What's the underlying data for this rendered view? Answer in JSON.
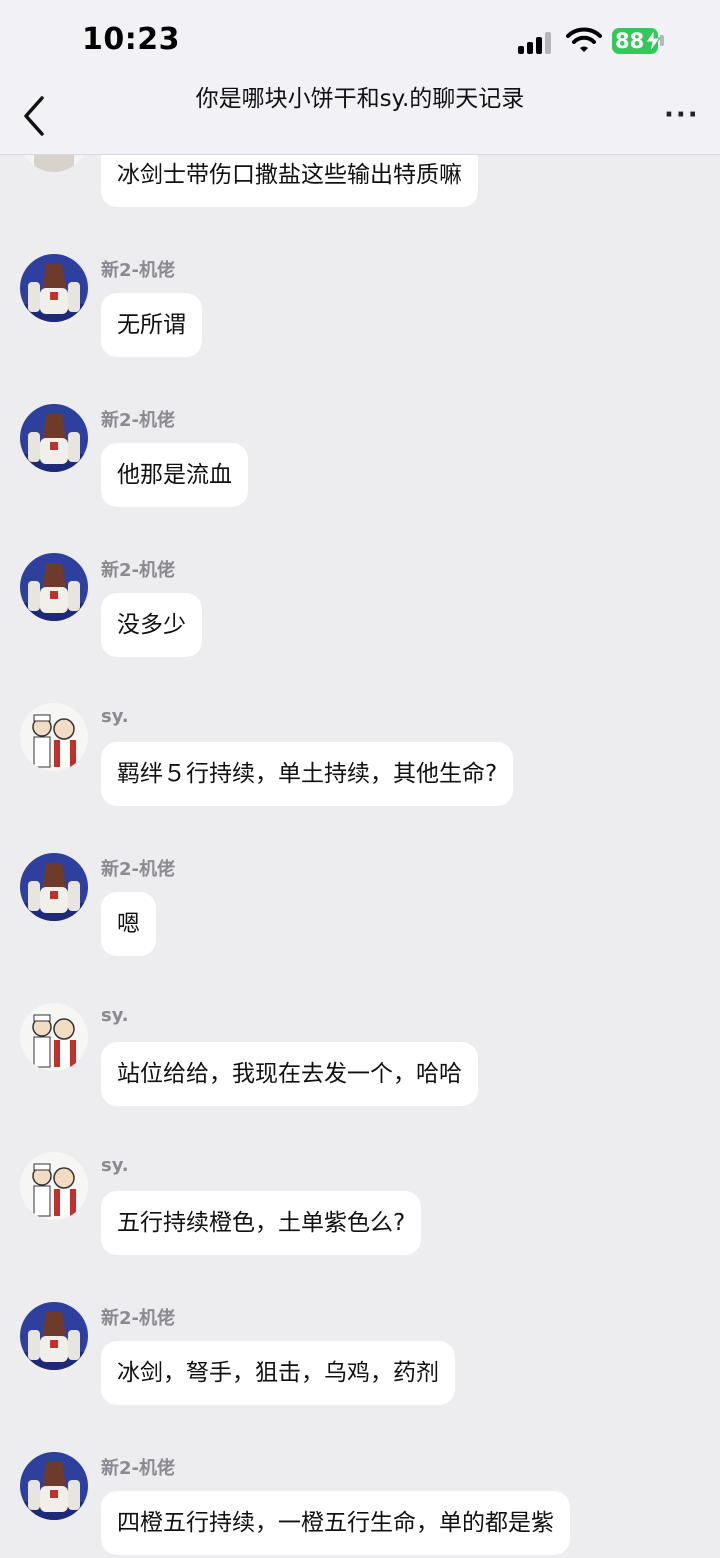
{
  "status_bar": {
    "time": "10:23",
    "battery": "88"
  },
  "nav": {
    "title": "你是哪块小饼干和sy.的聊天记录",
    "more": "···"
  },
  "messages": [
    {
      "sender": "",
      "avatar": "horse-avatar",
      "text": "冰剑士带伤口撒盐这些输出特质嘛"
    },
    {
      "sender": "新2-机佬",
      "avatar": "horse-avatar",
      "text": "无所谓"
    },
    {
      "sender": "新2-机佬",
      "avatar": "horse-avatar",
      "text": "他那是流血"
    },
    {
      "sender": "新2-机佬",
      "avatar": "horse-avatar",
      "text": "没多少"
    },
    {
      "sender": "sy.",
      "avatar": "cartoon-couple-avatar",
      "text": "羁绊５行持续，单土持续，其他生命?"
    },
    {
      "sender": "新2-机佬",
      "avatar": "horse-avatar",
      "text": "嗯"
    },
    {
      "sender": "sy.",
      "avatar": "cartoon-couple-avatar",
      "text": "站位给给，我现在去发一个，哈哈"
    },
    {
      "sender": "sy.",
      "avatar": "cartoon-couple-avatar",
      "text": "五行持续橙色，土单紫色么?"
    },
    {
      "sender": "新2-机佬",
      "avatar": "horse-avatar",
      "text": "冰剑，弩手，狙击，乌鸡，药剂"
    },
    {
      "sender": "新2-机佬",
      "avatar": "horse-avatar",
      "text": "四橙五行持续，一橙五行生命，单的都是紫"
    }
  ]
}
